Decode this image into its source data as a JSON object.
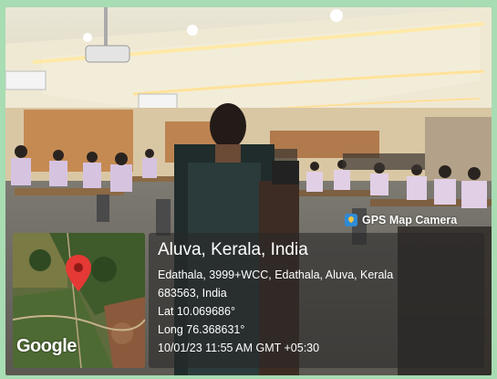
{
  "watermark": {
    "label": "GPS Map Camera",
    "icon": "gps-map-camera-icon"
  },
  "location": {
    "place": "Aluva, Kerala, India",
    "address_line1": "Edathala, 3999+WCC, Edathala, Aluva, Kerala",
    "address_line2": "683563, India",
    "lat": "Lat 10.069686°",
    "long": "Long 76.368631°",
    "datetime": "10/01/23 11:55 AM GMT +05:30"
  },
  "map": {
    "provider_logo": "Google",
    "pin_color": "#e53935"
  },
  "colors": {
    "frame": "#a8dcb2",
    "panel": "#282828"
  }
}
